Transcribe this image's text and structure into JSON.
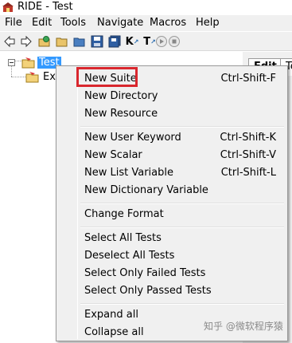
{
  "window": {
    "title": "RIDE - Test",
    "app_icon": "ride-app-icon"
  },
  "menubar": {
    "items": [
      "File",
      "Edit",
      "Tools",
      "Navigate",
      "Macros",
      "Help"
    ]
  },
  "toolbar": {
    "buttons": [
      {
        "icon": "back-arrow-icon"
      },
      {
        "icon": "forward-arrow-icon"
      },
      {
        "icon": "open-folder-green-icon"
      },
      {
        "icon": "open-folder-icon"
      },
      {
        "icon": "open-directory-icon"
      },
      {
        "icon": "save-icon"
      },
      {
        "icon": "save-all-icon"
      },
      {
        "icon": "keyword-search-icon",
        "text": "K"
      },
      {
        "icon": "test-search-icon",
        "text": "T"
      },
      {
        "icon": "run-icon"
      },
      {
        "icon": "stop-icon"
      }
    ]
  },
  "tree": {
    "root_label": "Test",
    "child_label": "Ext"
  },
  "right_pane": {
    "tab_edit": "Edit",
    "tab_next": "Te"
  },
  "context_menu": {
    "groups": [
      [
        {
          "label": "New Suite",
          "shortcut": "Ctrl-Shift-F"
        },
        {
          "label": "New Directory",
          "shortcut": ""
        },
        {
          "label": "New Resource",
          "shortcut": ""
        }
      ],
      [
        {
          "label": "New User Keyword",
          "shortcut": "Ctrl-Shift-K"
        },
        {
          "label": "New Scalar",
          "shortcut": "Ctrl-Shift-V"
        },
        {
          "label": "New List Variable",
          "shortcut": "Ctrl-Shift-L"
        },
        {
          "label": "New Dictionary Variable",
          "shortcut": ""
        }
      ],
      [
        {
          "label": "Change Format",
          "shortcut": ""
        }
      ],
      [
        {
          "label": "Select All Tests",
          "shortcut": ""
        },
        {
          "label": "Deselect All Tests",
          "shortcut": ""
        },
        {
          "label": "Select Only Failed Tests",
          "shortcut": ""
        },
        {
          "label": "Select Only Passed Tests",
          "shortcut": ""
        }
      ],
      [
        {
          "label": "Expand all",
          "shortcut": ""
        },
        {
          "label": "Collapse all",
          "shortcut": ""
        }
      ]
    ]
  },
  "annotation": {
    "highlight_color": "#d9272e",
    "highlighted_item": "New Suite"
  },
  "watermark": "知乎 @微软程序猿",
  "colors": {
    "selection": "#3399ff",
    "menu_bg": "#f0f0f0"
  }
}
